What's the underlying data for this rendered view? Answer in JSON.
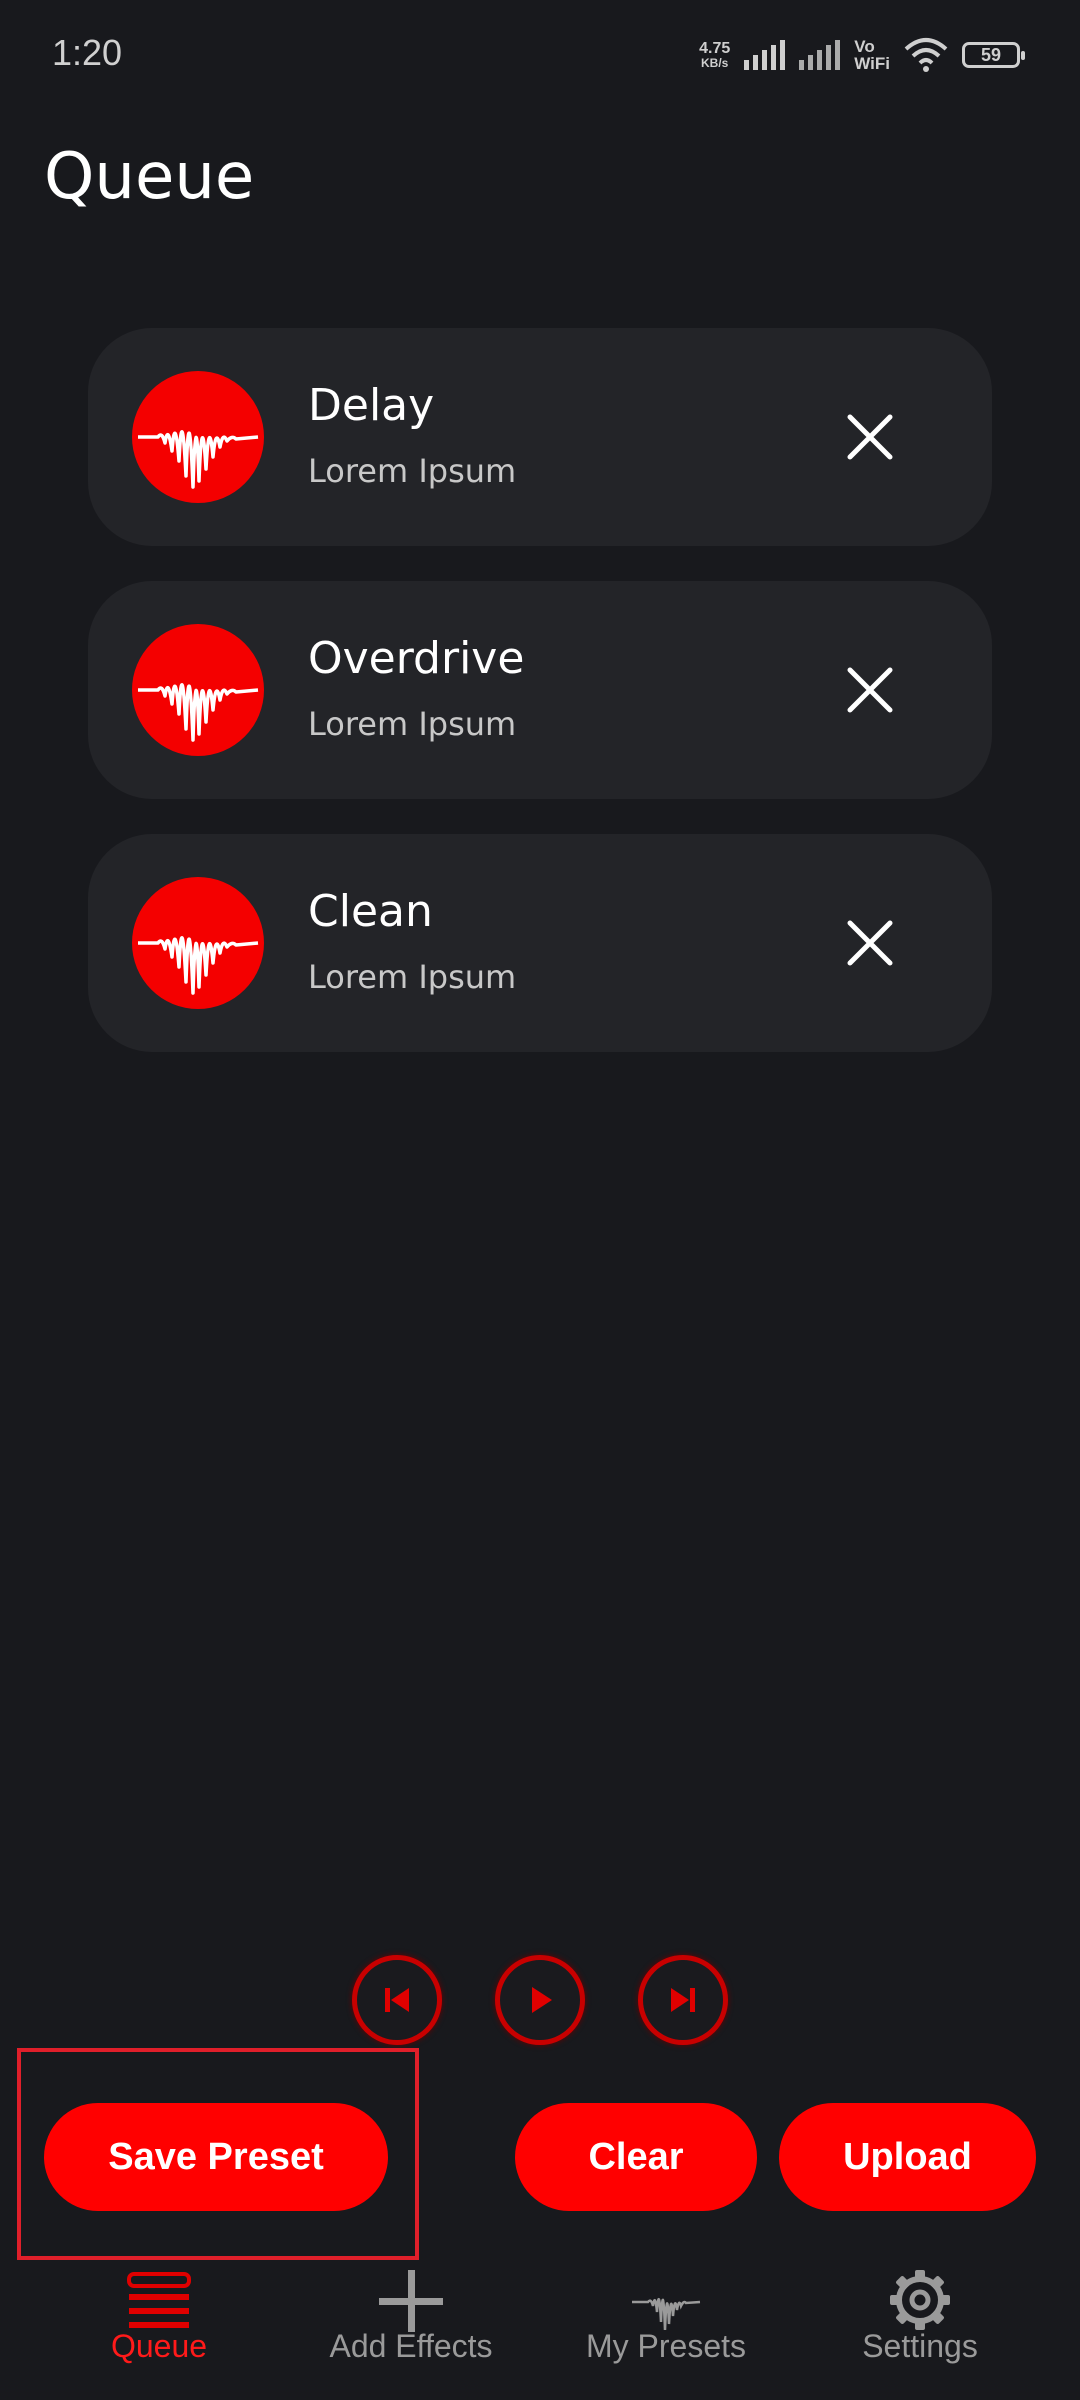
{
  "status_bar": {
    "time": "1:20",
    "net_speed_value": "4.75",
    "net_speed_unit": "KB/s",
    "vowifi_line1": "Vo",
    "vowifi_line2": "WiFi",
    "battery": "59"
  },
  "page": {
    "title": "Queue"
  },
  "queue": [
    {
      "title": "Delay",
      "subtitle": "Lorem Ipsum",
      "icon": "waveform-icon"
    },
    {
      "title": "Overdrive",
      "subtitle": "Lorem Ipsum",
      "icon": "waveform-icon"
    },
    {
      "title": "Clean",
      "subtitle": "Lorem Ipsum",
      "icon": "waveform-icon"
    }
  ],
  "transport": {
    "previous_icon": "skip-previous-icon",
    "play_icon": "play-icon",
    "next_icon": "skip-next-icon"
  },
  "actions": {
    "save_preset": "Save Preset",
    "clear": "Clear",
    "upload": "Upload"
  },
  "nav": [
    {
      "label": "Queue",
      "icon": "queue-list-icon",
      "active": true
    },
    {
      "label": "Add Effects",
      "icon": "plus-icon",
      "active": false
    },
    {
      "label": "My Presets",
      "icon": "waveform-icon",
      "active": false
    },
    {
      "label": "Settings",
      "icon": "gear-icon",
      "active": false
    }
  ],
  "colors": {
    "background": "#18191d",
    "card": "#232428",
    "accent": "#ff0000",
    "nav_inactive": "#9a9a9a"
  }
}
